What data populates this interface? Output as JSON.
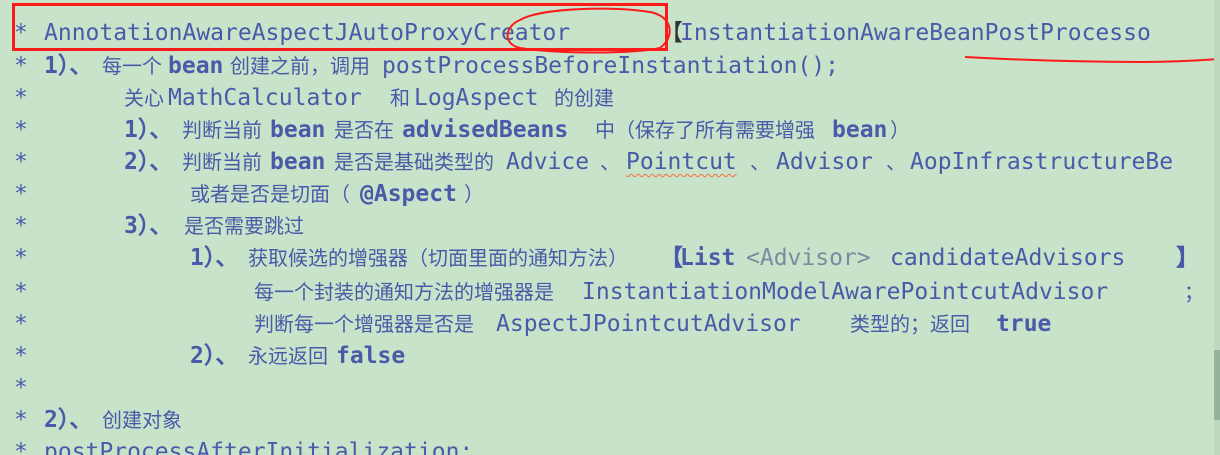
{
  "code_comment": {
    "line1": {
      "class_name": "AnnotationAwareAspectJAutoProxyCreator",
      "bracket": "【",
      "interface_name": "InstantiationAwareBeanPostProcesso"
    },
    "line2": {
      "num": "1）、",
      "pre": "每一个",
      "bean": "bean",
      "mid": "创建之前，调用",
      "method": "postProcessBeforeInstantiation();"
    },
    "line3": {
      "pre": "关心",
      "a": "MathCalculator",
      "mid": "和",
      "b": "LogAspect",
      "post": "的创建"
    },
    "line4": {
      "num": "1）、",
      "pre": "判断当前",
      "bean": "bean",
      "mid": "是否在",
      "field": "advisedBeans",
      "post1": "中（保存了所有需要增强",
      "bean2": "bean",
      "post2": "）"
    },
    "line5": {
      "num": "2）、",
      "pre": "判断当前",
      "bean": "bean",
      "mid": "是否是基础类型的",
      "advice": "Advice",
      "sep1": "、",
      "pointcut": "Pointcut",
      "sep2": "、",
      "advisor": "Advisor",
      "sep3": "、",
      "aop": "AopInfrastructureBe"
    },
    "line6": {
      "pre": "或者是否是切面（",
      "aspect": "@Aspect",
      "post": "）"
    },
    "line7": {
      "num": "3）、",
      "text": "是否需要跳过"
    },
    "line8": {
      "num": "1）、",
      "pre": "获取候选的增强器（切面里面的通知方法）",
      "open": "【",
      "list": "List",
      "generic": "<Advisor>",
      "var": " candidateAdvisors",
      "close": "】"
    },
    "line9": {
      "pre": "每一个封装的通知方法的增强器是 ",
      "cls": "InstantiationModelAwarePointcutAdvisor",
      "post": "；"
    },
    "line10": {
      "pre": "判断每一个增强器是否是 ",
      "cls": "AspectJPointcutAdvisor",
      "mid": " 类型的；返回",
      "val": "true"
    },
    "line11": {
      "num": "2）、",
      "pre": "永远返回",
      "val": "false"
    },
    "line13": {
      "num": "2）、",
      "text": "创建对象"
    },
    "line14": {
      "text": "postProcessAfterInitialization;"
    },
    "star": "*"
  },
  "colors": {
    "background": "#c7e4cb",
    "code_text": "#4a59a8",
    "annotation": "#ff1a1a"
  }
}
